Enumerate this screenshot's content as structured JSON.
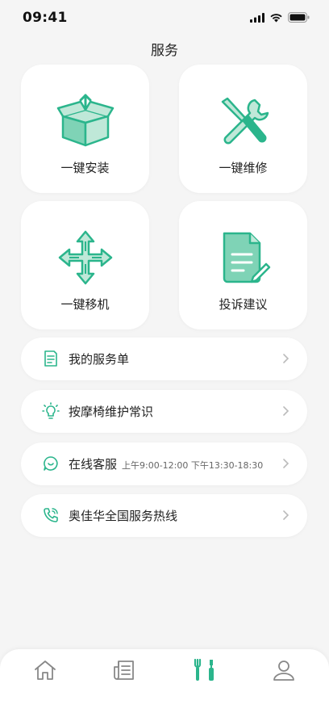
{
  "status": {
    "time": "09:41"
  },
  "page": {
    "title": "服务"
  },
  "cards": [
    {
      "label": "一键安装",
      "icon": "box-install-icon"
    },
    {
      "label": "一键维修",
      "icon": "tools-repair-icon"
    },
    {
      "label": "一键移机",
      "icon": "move-arrows-icon"
    },
    {
      "label": "投诉建议",
      "icon": "document-edit-icon"
    }
  ],
  "rows": [
    {
      "label": "我的服务单",
      "sub": "",
      "icon": "order-list-icon"
    },
    {
      "label": "按摩椅维护常识",
      "sub": "",
      "icon": "lightbulb-icon"
    },
    {
      "label": "在线客服",
      "sub": "上午9:00-12:00 下午13:30-18:30",
      "icon": "chat-icon"
    },
    {
      "label": "奥佳华全国服务热线",
      "sub": "",
      "icon": "phone-icon"
    }
  ],
  "tabs": [
    {
      "name": "home",
      "icon": "home-icon"
    },
    {
      "name": "news",
      "icon": "newspaper-icon"
    },
    {
      "name": "service",
      "icon": "tools-icon",
      "active": true
    },
    {
      "name": "profile",
      "icon": "user-icon"
    }
  ],
  "colors": {
    "accent": "#2bb58c",
    "accent_light": "#bfe8d8",
    "text": "#222222",
    "background": "#f5f5f5"
  }
}
